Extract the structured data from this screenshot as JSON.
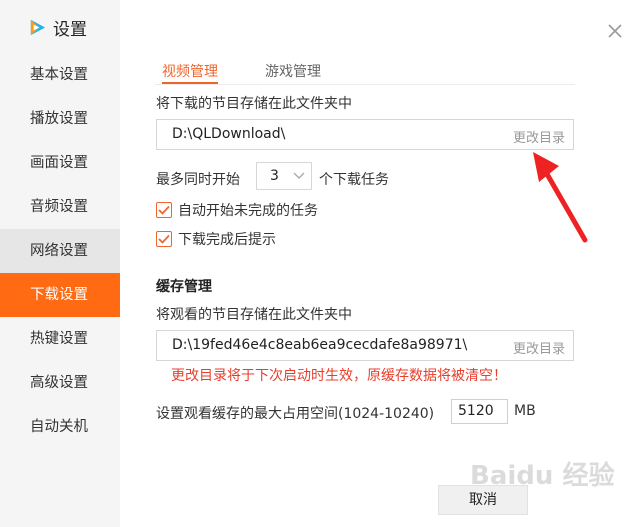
{
  "app": {
    "title": "设置",
    "logo_icon": "tencent-video-logo-icon"
  },
  "sidebar": {
    "items": [
      {
        "label": "基本设置"
      },
      {
        "label": "播放设置"
      },
      {
        "label": "画面设置"
      },
      {
        "label": "音频设置"
      },
      {
        "label": "网络设置"
      },
      {
        "label": "下载设置"
      },
      {
        "label": "热键设置"
      },
      {
        "label": "高级设置"
      },
      {
        "label": "自动关机"
      }
    ],
    "active_index": 5,
    "hover_index": 4
  },
  "tabs": [
    {
      "label": "视频管理",
      "active": true
    },
    {
      "label": "游戏管理",
      "active": false
    }
  ],
  "download": {
    "folder_label": "将下载的节目存储在此文件夹中",
    "path": "D:\\QLDownload\\",
    "change_label": "更改目录",
    "concurrent_prefix": "最多同时开始",
    "concurrent_value": "3",
    "concurrent_suffix": "个下载任务",
    "auto_start_label": "自动开始未完成的任务",
    "auto_start_checked": true,
    "notify_label": "下载完成后提示",
    "notify_checked": true
  },
  "cache": {
    "title": "缓存管理",
    "folder_label": "将观看的节目存储在此文件夹中",
    "path": "D:\\19fed46e4c8eab6ea9cecdafe8a98971\\",
    "change_label": "更改目录",
    "warning": "更改目录将于下次启动时生效，原缓存数据将被清空！",
    "size_label": "设置观看缓存的最大占用空间(1024-10240)",
    "size_value": "5120",
    "size_unit": "MB"
  },
  "footer": {
    "cancel_label": "取消"
  },
  "watermark": "Baidu 经验",
  "colors": {
    "accent": "#ff6a13",
    "warning": "#e83e2b",
    "arrow": "#ee2222"
  }
}
